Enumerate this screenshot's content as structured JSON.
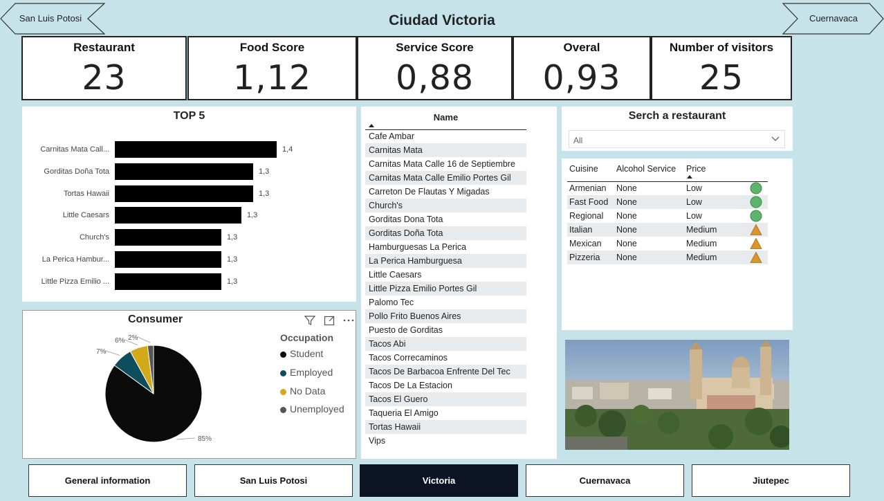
{
  "header": {
    "title": "Ciudad Victoria",
    "prev_city": "San Luis Potosi",
    "next_city": "Cuernavaca"
  },
  "kpis": [
    {
      "label": "Restaurant",
      "value": "23"
    },
    {
      "label": "Food Score",
      "value": "1,12"
    },
    {
      "label": "Service Score",
      "value": "0,88"
    },
    {
      "label": "Overal",
      "value": "0,93"
    },
    {
      "label": "Number of visitors",
      "value": "25"
    }
  ],
  "top5": {
    "title": "TOP 5",
    "chart_data": {
      "type": "bar",
      "orientation": "horizontal",
      "title": "TOP 5",
      "categories": [
        "Carnitas Mata Call...",
        "Gorditas Doña Tota",
        "Tortas Hawaii",
        "Little Caesars",
        "Church's",
        "La Perica Hambur...",
        "Little Pizza Emilio ..."
      ],
      "values": [
        1.4,
        1.3,
        1.3,
        1.3,
        1.3,
        1.3,
        1.3
      ],
      "value_labels": [
        "1,4",
        "1,3",
        "1,3",
        "1,3",
        "1,3",
        "1,3",
        "1,3"
      ],
      "bar_fraction": [
        1.0,
        0.856,
        0.856,
        0.782,
        0.66,
        0.66,
        0.66
      ],
      "color": "#000000"
    }
  },
  "consumer": {
    "title": "Consumer",
    "chart_data": {
      "type": "pie",
      "title": "Consumer",
      "legend_title": "Occupation",
      "legend_position": "right",
      "categories": [
        "Student",
        "Employed",
        "No Data",
        "Unemployed"
      ],
      "values": [
        85,
        7,
        6,
        2
      ],
      "value_labels": [
        "85%",
        "7%",
        "6%",
        "2%"
      ],
      "colors": [
        "#0b0b0b",
        "#0e4d5b",
        "#d1a91a",
        "#555555"
      ]
    }
  },
  "names": {
    "header": "Name",
    "items": [
      "Cafe Ambar",
      "Carnitas Mata",
      "Carnitas Mata Calle 16 de Septiembre",
      "Carnitas Mata Calle Emilio Portes Gil",
      "Carreton De Flautas Y Migadas",
      "Church's",
      "Gorditas Dona Tota",
      "Gorditas Doña Tota",
      "Hamburguesas La Perica",
      "La Perica Hamburguesa",
      "Little Caesars",
      "Little Pizza Emilio Portes Gil",
      "Palomo Tec",
      "Pollo Frito Buenos Aires",
      "Puesto de Gorditas",
      "Tacos Abi",
      "Tacos Correcaminos",
      "Tacos De Barbacoa Enfrente Del Tec",
      "Tacos De La Estacion",
      "Tacos El Guero",
      "Taqueria El Amigo",
      "Tortas Hawaii",
      "Vips"
    ]
  },
  "search": {
    "title": "Serch a restaurant",
    "selected": "All"
  },
  "cuisine_table": {
    "headers": [
      "Cuisine",
      "Alcohol Service",
      "Price"
    ],
    "rows": [
      {
        "cuisine": "Armenian",
        "alcohol": "None",
        "price": "Low",
        "icon": "green-circle"
      },
      {
        "cuisine": "Fast Food",
        "alcohol": "None",
        "price": "Low",
        "icon": "green-circle"
      },
      {
        "cuisine": "Regional",
        "alcohol": "None",
        "price": "Low",
        "icon": "green-circle"
      },
      {
        "cuisine": "Italian",
        "alcohol": "None",
        "price": "Medium",
        "icon": "orange-triangle"
      },
      {
        "cuisine": "Mexican",
        "alcohol": "None",
        "price": "Medium",
        "icon": "orange-triangle"
      },
      {
        "cuisine": "Pizzeria",
        "alcohol": "None",
        "price": "Medium",
        "icon": "orange-triangle"
      }
    ]
  },
  "tabs": [
    {
      "label": "General information",
      "active": false
    },
    {
      "label": "San Luis Potosi",
      "active": false
    },
    {
      "label": "Victoria",
      "active": true
    },
    {
      "label": "Cuernavaca",
      "active": false
    },
    {
      "label": "Jiutepec",
      "active": false
    }
  ],
  "colors": {
    "background": "#c6e3ea",
    "active_tab": "#0c1424",
    "low_price": "#5cb56b",
    "medium_price": "#d9962b"
  }
}
